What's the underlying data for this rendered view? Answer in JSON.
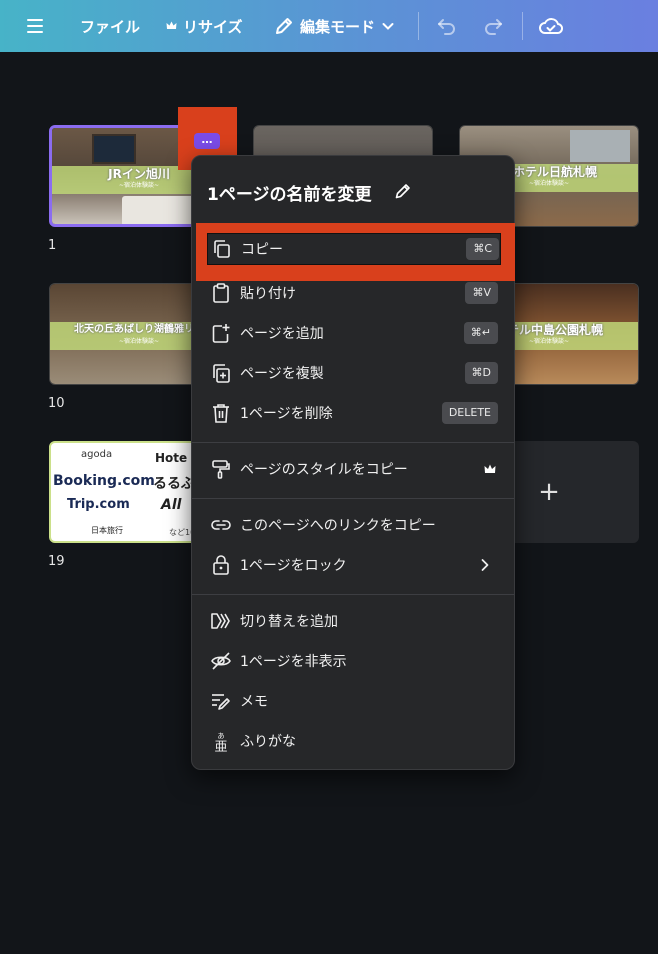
{
  "toolbar": {
    "file_label": "ファイル",
    "resize_label": "リサイズ",
    "edit_mode_label": "編集モード"
  },
  "pages": [
    {
      "number": "1",
      "title": "JRイン旭川",
      "subtitle": "~宿泊体験談~"
    },
    {
      "number": "",
      "title": "",
      "subtitle": ""
    },
    {
      "number": "",
      "title": "ーホテル日航札幌",
      "subtitle": "~宿泊体験談~"
    },
    {
      "number": "10",
      "title": "北天の丘あばしり湖鶴雅リゾ",
      "subtitle": "~宿泊体験談~"
    },
    {
      "number": "",
      "title": "ホテル中島公園札幌",
      "subtitle": "~宿泊体験談~"
    },
    {
      "number": "19",
      "title": "",
      "subtitle": ""
    }
  ],
  "logos": [
    "agoda",
    "Hote",
    "Booking.com",
    "るるぶ",
    "Trip.com",
    "All",
    "日本旅行",
    "など10"
  ],
  "add_page_label": "+",
  "more_button_label": "…",
  "context_menu": {
    "title": "1ページの名前を変更",
    "items": [
      {
        "label": "コピー",
        "shortcut": "⌘C",
        "icon": "copy-icon"
      },
      {
        "label": "貼り付け",
        "shortcut": "⌘V",
        "icon": "paste-icon"
      },
      {
        "label": "ページを追加",
        "shortcut": "⌘↵",
        "icon": "add-page-icon"
      },
      {
        "label": "ページを複製",
        "shortcut": "⌘D",
        "icon": "duplicate-icon"
      },
      {
        "label": "1ページを削除",
        "shortcut": "DELETE",
        "icon": "trash-icon"
      },
      {
        "label": "ページのスタイルをコピー",
        "shortcut": "",
        "icon": "paint-roller-icon"
      },
      {
        "label": "このページへのリンクをコピー",
        "shortcut": "",
        "icon": "link-icon"
      },
      {
        "label": "1ページをロック",
        "shortcut": "",
        "icon": "lock-icon"
      },
      {
        "label": "切り替えを追加",
        "shortcut": "",
        "icon": "transition-icon"
      },
      {
        "label": "1ページを非表示",
        "shortcut": "",
        "icon": "eye-off-icon"
      },
      {
        "label": "メモ",
        "shortcut": "",
        "icon": "note-icon"
      },
      {
        "label": "ふりがな",
        "shortcut": "",
        "icon": "furigana-icon"
      }
    ]
  },
  "colors": {
    "toolbar_start": "#47b3c8",
    "toolbar_end": "#6a7fe0",
    "background": "#121519",
    "menu_bg": "#262729",
    "highlight": "#d9401c",
    "selected_border": "#8b6cf0"
  }
}
